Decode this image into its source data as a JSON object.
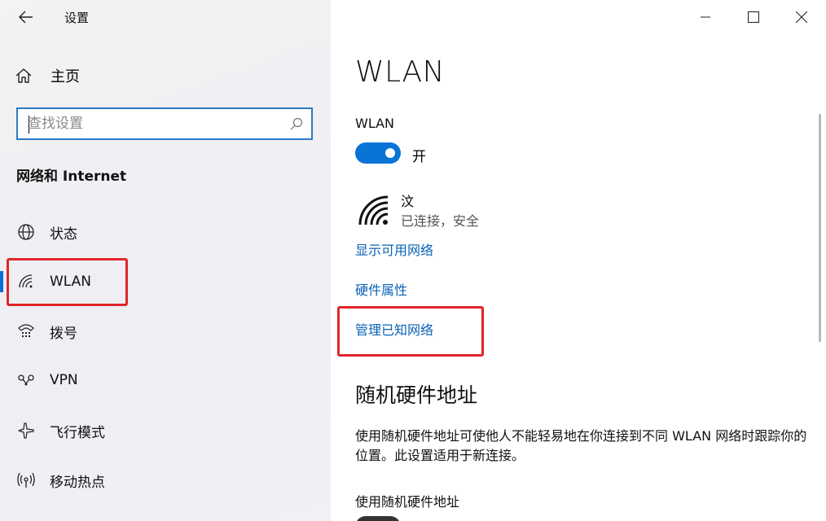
{
  "window": {
    "title": "设置"
  },
  "sidebar": {
    "home_label": "主页",
    "search": {
      "placeholder": "查找设置",
      "value": ""
    },
    "section_title": "网络和 Internet",
    "items": [
      {
        "label": "状态",
        "icon": "globe-icon"
      },
      {
        "label": "WLAN",
        "icon": "wifi-icon",
        "selected": true
      },
      {
        "label": "拨号",
        "icon": "dialup-icon"
      },
      {
        "label": "VPN",
        "icon": "vpn-icon"
      },
      {
        "label": "飞行模式",
        "icon": "airplane-icon"
      },
      {
        "label": "移动热点",
        "icon": "hotspot-icon"
      }
    ]
  },
  "main": {
    "title": "WLAN",
    "wlan_toggle": {
      "label": "WLAN",
      "state_label": "开",
      "on": true
    },
    "network": {
      "ssid": "汶",
      "status": "已连接，安全"
    },
    "links": {
      "show_available": "显示可用网络",
      "hardware_properties": "硬件属性",
      "manage_known": "管理已知网络"
    },
    "random_mac": {
      "heading": "随机硬件地址",
      "description": "使用随机硬件地址可使他人不能轻易地在你连接到不同 WLAN 网络时跟踪你的位置。此设置适用于新连接。",
      "toggle_label": "使用随机硬件地址"
    }
  },
  "colors": {
    "accent": "#0a74d6",
    "link": "#0a63b5",
    "highlight_box": "#e0262b"
  }
}
